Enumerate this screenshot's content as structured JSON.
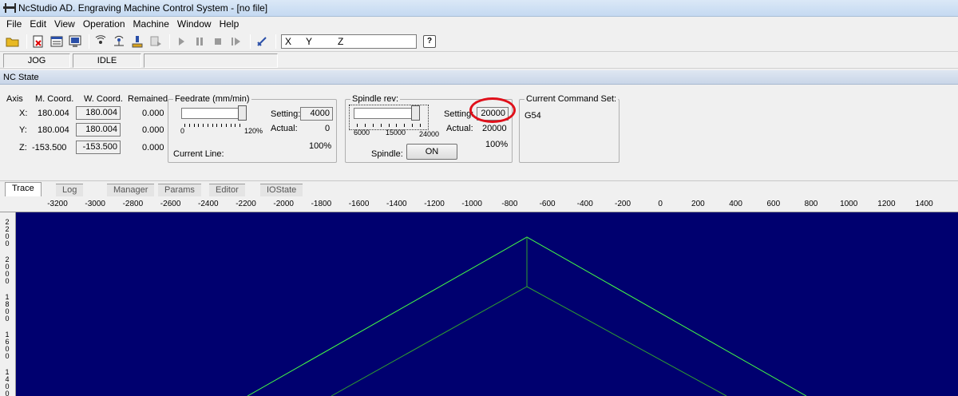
{
  "window": {
    "title": "NcStudio AD. Engraving Machine Control System  - [no file]"
  },
  "menu": [
    "File",
    "Edit",
    "View",
    "Operation",
    "Machine",
    "Window",
    "Help"
  ],
  "toolbar": {
    "axis_input": {
      "x": "X",
      "y": "Y",
      "z": "Z"
    },
    "help_label": "?"
  },
  "status": {
    "mode": "JOG",
    "state": "IDLE"
  },
  "nc_state": {
    "header": "NC State",
    "columns": {
      "axis": "Axis",
      "mcoord": "M. Coord.",
      "wcoord": "W. Coord.",
      "remained": "Remained"
    },
    "axes": [
      {
        "name": "X:",
        "m": "180.004",
        "w": "180.004",
        "r": "0.000"
      },
      {
        "name": "Y:",
        "m": "180.004",
        "w": "180.004",
        "r": "0.000"
      },
      {
        "name": "Z:",
        "m": "-153.500",
        "w": "-153.500",
        "r": "0.000"
      }
    ],
    "feedrate": {
      "legend": "Feedrate (mm/min)",
      "setting_label": "Setting:",
      "setting": "4000",
      "actual_label": "Actual:",
      "actual": "0",
      "percent": "100%",
      "scale_min": "0",
      "scale_max": "120%",
      "current_line_label": "Current Line:"
    },
    "spindle": {
      "legend": "Spindle rev:",
      "setting_label": "Setting:",
      "setting": "20000",
      "actual_label": "Actual:",
      "actual": "20000",
      "percent": "100%",
      "scale": [
        "6000",
        "15000",
        "24000"
      ],
      "spindle_label": "Spindle:",
      "on_label": "ON"
    },
    "command_set": {
      "legend": "Current Command Set:",
      "value": "G54"
    }
  },
  "tabs": [
    {
      "label": "Trace",
      "active": true
    },
    {
      "label": "Log",
      "active": false
    },
    {
      "label": "Manager",
      "active": false
    },
    {
      "label": "Params",
      "active": false
    },
    {
      "label": "Editor",
      "active": false
    },
    {
      "label": "IOState",
      "active": false
    }
  ],
  "ruler": {
    "x_labels": [
      "-3200",
      "-3000",
      "-2800",
      "-2600",
      "-2400",
      "-2200",
      "-2000",
      "-1800",
      "-1600",
      "-1400",
      "-1200",
      "-1000",
      "-800",
      "-600",
      "-400",
      "-200",
      "0",
      "200",
      "400",
      "600",
      "800",
      "1000",
      "1200",
      "1400"
    ],
    "y_labels": [
      "2200",
      "2000",
      "1800",
      "1600",
      "1400"
    ]
  },
  "colors": {
    "canvas_bg": "#00006f",
    "trace_line": "#44ff44",
    "highlight": "#e0101a"
  }
}
